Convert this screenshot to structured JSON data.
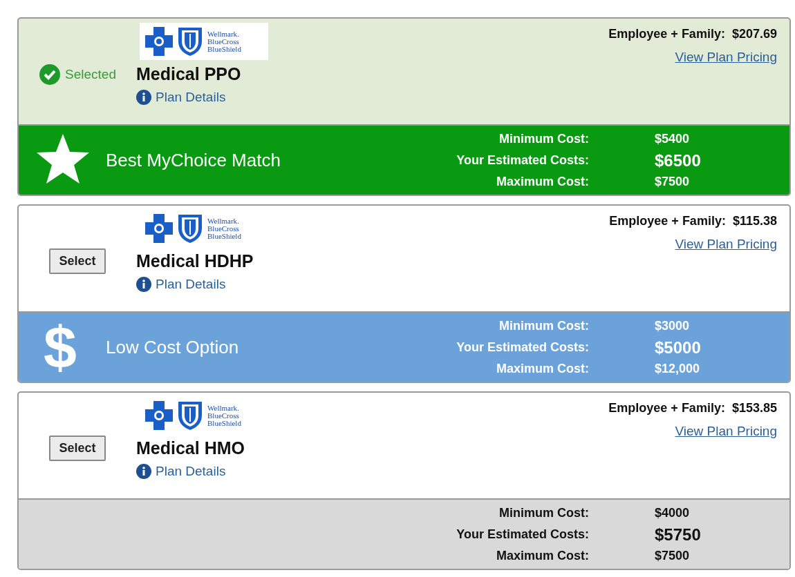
{
  "plans": [
    {
      "selected": true,
      "action_label": "Selected",
      "logo_lines": [
        "Wellmark.",
        "BlueCross",
        "BlueShield"
      ],
      "name": "Medical PPO",
      "details_link": "Plan Details",
      "premium_label": "Employee + Family:",
      "premium": "$207.69",
      "pricing_link": "View Plan Pricing",
      "banner": {
        "kind": "match",
        "label": "Best MyChoice Match"
      },
      "costs": [
        {
          "label": "Minimum Cost:",
          "value": "$5400",
          "kind": "min"
        },
        {
          "label": "Your Estimated Costs:",
          "value": "$6500",
          "kind": "estimate"
        },
        {
          "label": "Maximum Cost:",
          "value": "$7500",
          "kind": "max"
        }
      ]
    },
    {
      "selected": false,
      "action_label": "Select",
      "logo_lines": [
        "Wellmark.",
        "BlueCross",
        "BlueShield"
      ],
      "name": "Medical HDHP",
      "details_link": "Plan Details",
      "premium_label": "Employee + Family:",
      "premium": "$115.38",
      "pricing_link": "View Plan Pricing",
      "banner": {
        "kind": "low_cost",
        "icon_text": "$",
        "label": "Low Cost Option"
      },
      "costs": [
        {
          "label": "Minimum Cost:",
          "value": "$3000",
          "kind": "min"
        },
        {
          "label": "Your Estimated Costs:",
          "value": "$5000",
          "kind": "estimate"
        },
        {
          "label": "Maximum Cost:",
          "value": "$12,000",
          "kind": "max"
        }
      ]
    },
    {
      "selected": false,
      "action_label": "Select",
      "logo_lines": [
        "Wellmark.",
        "BlueCross",
        "BlueShield"
      ],
      "name": "Medical HMO",
      "details_link": "Plan Details",
      "premium_label": "Employee + Family:",
      "premium": "$153.85",
      "pricing_link": "View Plan Pricing",
      "banner": {
        "kind": "none"
      },
      "costs": [
        {
          "label": "Minimum Cost:",
          "value": "$4000",
          "kind": "min"
        },
        {
          "label": "Your Estimated Costs:",
          "value": "$5750",
          "kind": "estimate"
        },
        {
          "label": "Maximum Cost:",
          "value": "$7500",
          "kind": "max"
        }
      ]
    }
  ]
}
